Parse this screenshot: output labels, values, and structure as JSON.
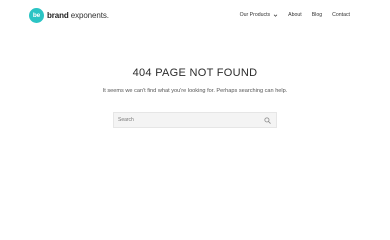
{
  "logo": {
    "badge": "be",
    "brand_bold": "brand",
    "brand_light": "exponents."
  },
  "nav": {
    "items": [
      {
        "label": "Our Products",
        "has_dropdown": true
      },
      {
        "label": "About"
      },
      {
        "label": "Blog"
      },
      {
        "label": "Contact"
      }
    ]
  },
  "main": {
    "title": "404 PAGE NOT FOUND",
    "message": "It seems we can't find what you're looking for. Perhaps searching can help."
  },
  "search": {
    "placeholder": "Search",
    "value": ""
  },
  "colors": {
    "accent": "#2bc4c4",
    "background": "#ffffff",
    "search_bg": "#f4f4f4"
  },
  "icons": {
    "search": "search-icon",
    "dropdown": "chevron-down-icon"
  }
}
